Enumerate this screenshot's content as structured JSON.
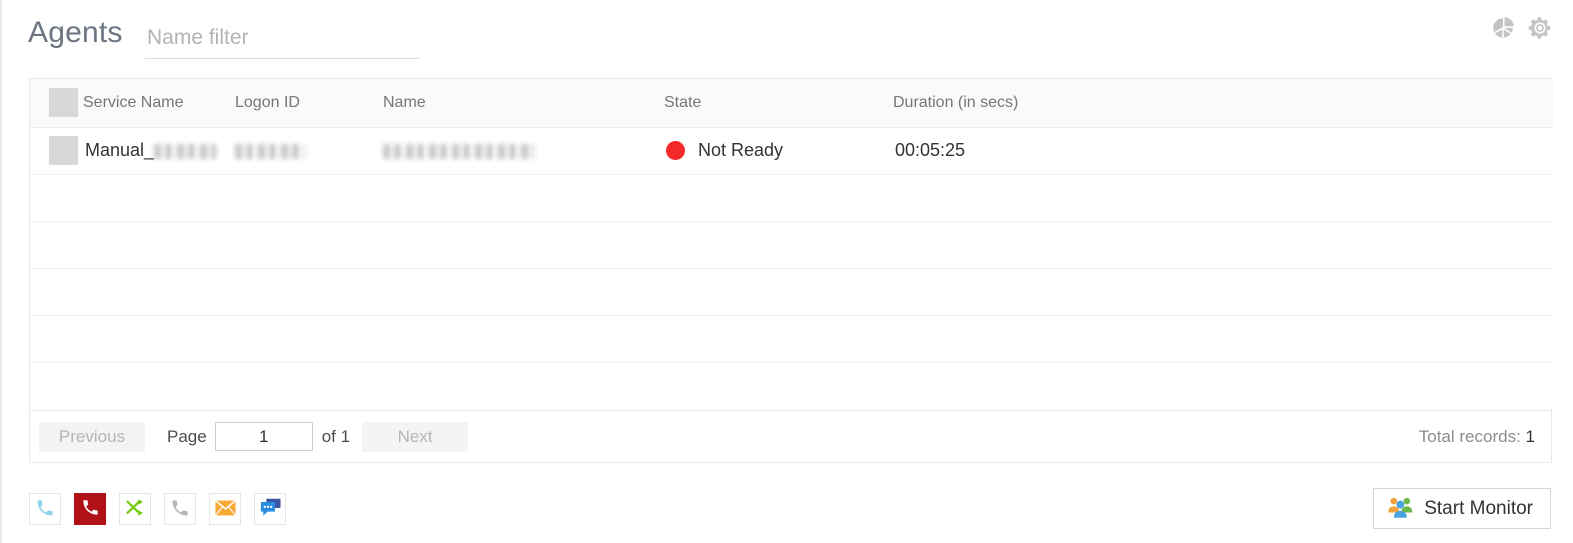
{
  "header": {
    "title": "Agents",
    "filter_placeholder": "Name filter",
    "filter_value": "",
    "icons": [
      {
        "name": "pie-chart-icon",
        "color": "#c4c4c4"
      },
      {
        "name": "gear-icon",
        "color": "#c4c4c4"
      }
    ]
  },
  "table": {
    "columns": [
      {
        "key": "select",
        "label": ""
      },
      {
        "key": "service_name",
        "label": "Service Name"
      },
      {
        "key": "logon_id",
        "label": "Logon ID"
      },
      {
        "key": "name",
        "label": "Name"
      },
      {
        "key": "state",
        "label": "State"
      },
      {
        "key": "duration",
        "label": "Duration (in secs)"
      }
    ],
    "rows": [
      {
        "service_name_visible": "Manual_",
        "service_name_redacted": true,
        "logon_id_redacted": true,
        "name_redacted": true,
        "state": "Not Ready",
        "state_color": "#f42a2a",
        "duration": "00:05:25"
      }
    ],
    "empty_row_count": 5
  },
  "pagination": {
    "previous_label": "Previous",
    "page_label": "Page",
    "page_value": "1",
    "of_label": "of 1",
    "next_label": "Next",
    "total_records_label": "Total records:",
    "total_records_value": "1"
  },
  "toolbar": {
    "buttons": [
      {
        "name": "answer-call-icon",
        "tone": "blue"
      },
      {
        "name": "hangup-call-icon",
        "tone": "red-filled"
      },
      {
        "name": "transfer-call-icon",
        "tone": "green"
      },
      {
        "name": "hold-call-icon",
        "tone": "gray"
      },
      {
        "name": "email-icon",
        "tone": "orange"
      },
      {
        "name": "chat-icon",
        "tone": "blue-chat"
      }
    ]
  },
  "actions": {
    "start_monitor_label": "Start Monitor"
  }
}
